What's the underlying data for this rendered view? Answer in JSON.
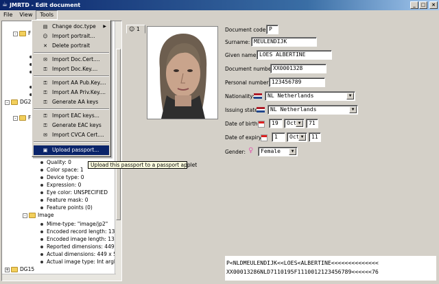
{
  "window": {
    "title": "JMRTD - Edit document",
    "controls": [
      "_",
      "□",
      "×"
    ]
  },
  "menubar": {
    "items": [
      "File",
      "View",
      "Tools"
    ]
  },
  "tree": {
    "rows": [
      {
        "kind": "folder",
        "toggle": "-",
        "label": "F",
        "level": 1
      },
      {
        "kind": "dot",
        "label": "D",
        "level": 2
      },
      {
        "kind": "dot",
        "label": "N",
        "level": 2
      },
      {
        "kind": "dot",
        "label": "D",
        "level": 2
      },
      {
        "kind": "dot",
        "label": "D",
        "level": 2
      },
      {
        "kind": "dot",
        "label": "P",
        "level": 2
      },
      {
        "kind": "folder",
        "toggle": "-",
        "label": "DG2",
        "level": 0
      },
      {
        "kind": "folder",
        "toggle": "-",
        "label": "F",
        "level": 1
      },
      {
        "kind": "dot",
        "label": "Quality: 0",
        "level": 3
      },
      {
        "kind": "dot",
        "label": "Color space: 1",
        "level": 3
      },
      {
        "kind": "dot",
        "label": "Device type: 0",
        "level": 3
      },
      {
        "kind": "dot",
        "label": "Expression: 0",
        "level": 3
      },
      {
        "kind": "dot",
        "label": "Eye color: UNSPECIFIED",
        "level": 3
      },
      {
        "kind": "dot",
        "label": "Feature mask: 0",
        "level": 3
      },
      {
        "kind": "dot",
        "label": "Feature points (0)",
        "level": 3
      },
      {
        "kind": "folder",
        "toggle": "-",
        "label": "Image",
        "level": 2
      },
      {
        "kind": "dot",
        "label": "Mime-type: \"image/jp2\"",
        "level": 3
      },
      {
        "kind": "dot",
        "label": "Encoded record length: 1373",
        "level": 3
      },
      {
        "kind": "dot",
        "label": "Encoded image length: 1370",
        "level": 3
      },
      {
        "kind": "dot",
        "label": "Reported dimensions: 449 x",
        "level": 3
      },
      {
        "kind": "dot",
        "label": "Actual dimensions: 449 x 598",
        "level": 3
      },
      {
        "kind": "dot",
        "label": "Actual image type: Int argb",
        "level": 3
      },
      {
        "kind": "folder",
        "toggle": "+",
        "label": "DG15",
        "level": 0
      }
    ],
    "peek_texts": [
      "12",
      "9"
    ]
  },
  "tools_menu": {
    "items": [
      {
        "label": "Change doc.type",
        "icon": "document-icon",
        "submenu": true
      },
      {
        "label": "Import portrait...",
        "icon": "portrait-icon"
      },
      {
        "label": "Delete portrait",
        "icon": "delete-icon"
      },
      {
        "label": "Import Doc.Cert....",
        "icon": "certificate-icon"
      },
      {
        "label": "Import Doc.Key....",
        "icon": "key-icon"
      },
      {
        "label": "Import AA Pub.Key....",
        "icon": "key-icon"
      },
      {
        "label": "Import AA Priv.Key....",
        "icon": "key-icon"
      },
      {
        "label": "Generate AA keys",
        "icon": "key-icon"
      },
      {
        "label": "Import EAC keys...",
        "icon": "key-icon"
      },
      {
        "label": "Generate EAC keys",
        "icon": "key-icon"
      },
      {
        "label": "Import CVCA Cert....",
        "icon": "certificate-icon"
      },
      {
        "label": "Upload passport...",
        "icon": "passport-icon",
        "highlighted": true
      }
    ],
    "tooltip": "Upload this passport to a passport applet"
  },
  "document": {
    "photo_tab_label": "1",
    "fields": {
      "document_code": {
        "label": "Document code:",
        "value": "P"
      },
      "surname": {
        "label": "Surname:",
        "value": "MEULENDIJK"
      },
      "given_names": {
        "label": "Given names:",
        "value": "LOES ALBERTINE"
      },
      "document_number": {
        "label": "Document number:",
        "value": "XX0001328"
      },
      "personal_number": {
        "label": "Personal number:",
        "value": "123456789"
      },
      "nationality": {
        "label": "Nationality:",
        "value": "NL Netherlands"
      },
      "issuing_state": {
        "label": "Issuing state:",
        "value": "NL Netherlands"
      },
      "date_of_birth": {
        "label": "Date of birth:",
        "day": "19",
        "month": "Oct",
        "year": "71"
      },
      "date_of_expiry": {
        "label": "Date of expiry:",
        "day": "1",
        "month": "Oct",
        "year": "11"
      },
      "gender": {
        "label": "Gender:",
        "value": "Female"
      }
    },
    "mrz": {
      "line1": "P<NLDMEULENDIJK<<LOES<ALBERTINE<<<<<<<<<<<<<<",
      "line2": "XX00013286NLD7110195F1110012123456789<<<<<<76"
    }
  },
  "colors": {
    "selection": "#0a246a",
    "flag_red": "#ae1c28",
    "flag_blue": "#21468b",
    "folder": "#f2cf5c"
  }
}
